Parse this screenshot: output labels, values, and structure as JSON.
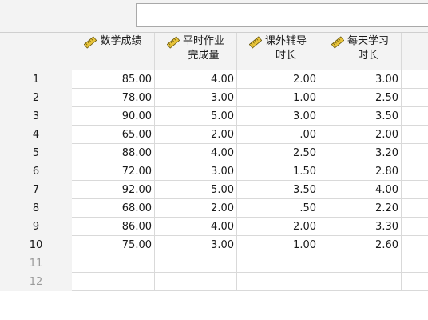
{
  "cell_editor": {
    "value": ""
  },
  "columns": [
    {
      "label": "数学成绩",
      "icon": "ruler-scale-icon"
    },
    {
      "label": "平时作业\n完成量",
      "icon": "ruler-scale-icon"
    },
    {
      "label": "课外辅导\n时长",
      "icon": "ruler-scale-icon"
    },
    {
      "label": "每天学习\n时长",
      "icon": "ruler-scale-icon"
    }
  ],
  "rows": [
    {
      "num": "1",
      "cells": [
        "85.00",
        "4.00",
        "2.00",
        "3.00"
      ]
    },
    {
      "num": "2",
      "cells": [
        "78.00",
        "3.00",
        "1.00",
        "2.50"
      ]
    },
    {
      "num": "3",
      "cells": [
        "90.00",
        "5.00",
        "3.00",
        "3.50"
      ]
    },
    {
      "num": "4",
      "cells": [
        "65.00",
        "2.00",
        ".00",
        "2.00"
      ]
    },
    {
      "num": "5",
      "cells": [
        "88.00",
        "4.00",
        "2.50",
        "3.20"
      ]
    },
    {
      "num": "6",
      "cells": [
        "72.00",
        "3.00",
        "1.50",
        "2.80"
      ]
    },
    {
      "num": "7",
      "cells": [
        "92.00",
        "5.00",
        "3.50",
        "4.00"
      ]
    },
    {
      "num": "8",
      "cells": [
        "68.00",
        "2.00",
        ".50",
        "2.20"
      ]
    },
    {
      "num": "9",
      "cells": [
        "86.00",
        "4.00",
        "2.00",
        "3.30"
      ]
    },
    {
      "num": "10",
      "cells": [
        "75.00",
        "3.00",
        "1.00",
        "2.60"
      ]
    },
    {
      "num": "11",
      "cells": [
        "",
        "",
        "",
        ""
      ],
      "empty": true
    },
    {
      "num": "12",
      "cells": [
        "",
        "",
        "",
        ""
      ],
      "empty": true
    }
  ]
}
